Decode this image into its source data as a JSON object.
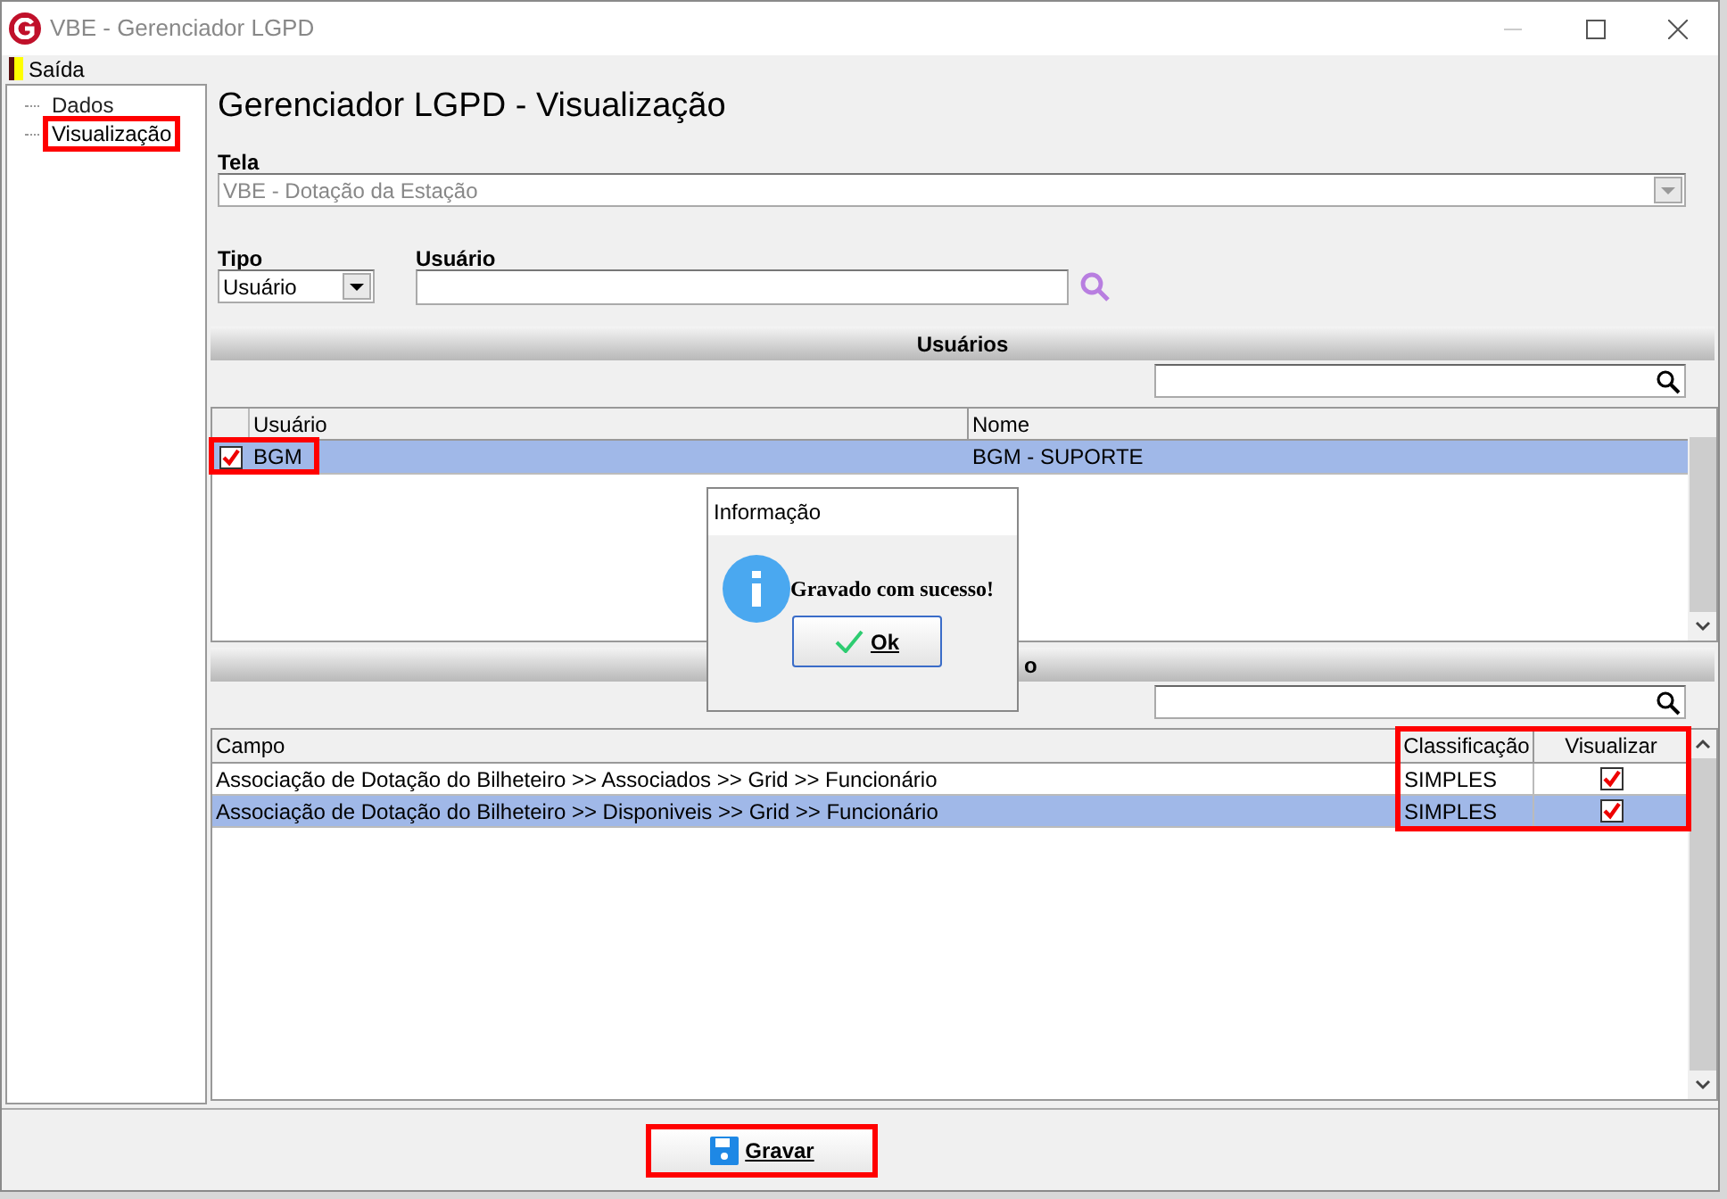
{
  "window": {
    "title": "VBE - Gerenciador LGPD"
  },
  "menu": [
    {
      "label": "Saída"
    }
  ],
  "tree": [
    {
      "label": "Dados",
      "selected": false,
      "highlighted": false
    },
    {
      "label": "Visualização",
      "selected": true,
      "highlighted": true
    }
  ],
  "heading": "Gerenciador LGPD - Visualização",
  "tela": {
    "label": "Tela",
    "value": "VBE - Dotação da Estação",
    "disabled": true
  },
  "tipo": {
    "label": "Tipo",
    "value": "Usuário"
  },
  "usuario": {
    "label": "Usuário"
  },
  "users_section": {
    "title": "Usuários",
    "columns": [
      "Usuário",
      "Nome"
    ],
    "rows": [
      {
        "checked": true,
        "selected": true,
        "highlighted": true,
        "cells": [
          "BGM",
          "BGM - SUPORTE"
        ]
      }
    ]
  },
  "fields_section": {
    "title": "o",
    "columns": [
      "Campo",
      "Classificação",
      "Visualizar"
    ],
    "highlight_columns": true,
    "rows": [
      {
        "selected": false,
        "visualizar": true,
        "cells": [
          "Associação de Dotação do Bilheteiro >> Associados >> Grid >> Funcionário",
          "SIMPLES"
        ]
      },
      {
        "selected": true,
        "visualizar": true,
        "cells": [
          "Associação de Dotação do Bilheteiro >> Disponiveis >> Grid >> Funcionário",
          "SIMPLES"
        ]
      }
    ]
  },
  "save_button": {
    "label": "Gravar",
    "highlighted": true
  },
  "dialog": {
    "title": "Informação",
    "message": "Gravado com sucesso!",
    "button": "Ok"
  }
}
